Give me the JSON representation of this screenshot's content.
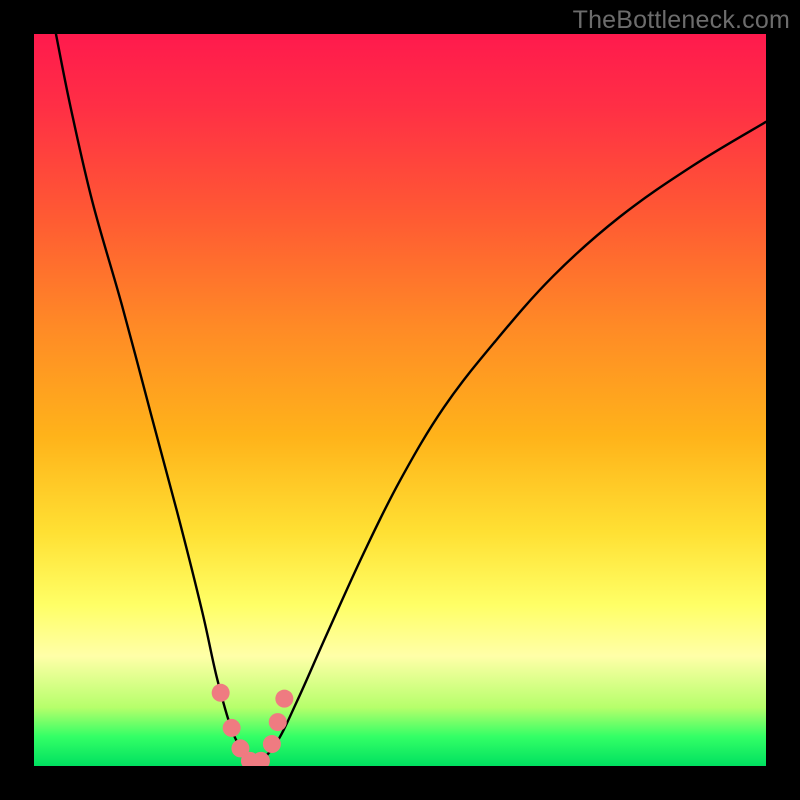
{
  "watermark": {
    "text": "TheBottleneck.com"
  },
  "colors": {
    "background": "#000000",
    "curve": "#000000",
    "marker_fill": "#ef7b81",
    "marker_stroke": "#d9596a",
    "gradient_top": "#ff1a4d",
    "gradient_bottom": "#00e060"
  },
  "chart_data": {
    "type": "line",
    "title": "",
    "xlabel": "",
    "ylabel": "",
    "xlim": [
      0,
      100
    ],
    "ylim": [
      0,
      100
    ],
    "grid": false,
    "series": [
      {
        "name": "bottleneck-curve",
        "x": [
          3,
          5,
          8,
          12,
          16,
          20,
          23,
          25,
          27,
          29,
          30,
          33,
          36,
          40,
          45,
          50,
          56,
          63,
          71,
          80,
          90,
          100
        ],
        "values": [
          100,
          90,
          77,
          63,
          48,
          33,
          21,
          12,
          5,
          1,
          0,
          3,
          9,
          18,
          29,
          39,
          49,
          58,
          67,
          75,
          82,
          88
        ]
      }
    ],
    "markers": {
      "name": "sweet-spot",
      "x": [
        25.5,
        27.0,
        28.2,
        29.5,
        31.0,
        32.5,
        33.3,
        34.2
      ],
      "values": [
        10.0,
        5.2,
        2.4,
        0.7,
        0.7,
        3.0,
        6.0,
        9.2
      ],
      "radius_px": 9
    }
  }
}
